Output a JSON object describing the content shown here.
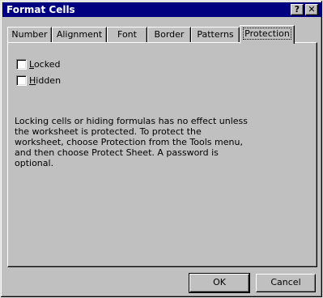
{
  "window": {
    "title": "Format Cells",
    "help_label": "?",
    "close_label": "✕"
  },
  "tabs": [
    {
      "label": "Number"
    },
    {
      "label": "Alignment"
    },
    {
      "label": "Font"
    },
    {
      "label": "Border"
    },
    {
      "label": "Patterns"
    },
    {
      "label": "Protection"
    }
  ],
  "active_tab": "Protection",
  "protection": {
    "locked": {
      "first": "L",
      "rest": "ocked",
      "checked": false
    },
    "hidden": {
      "first": "H",
      "rest": "idden",
      "checked": false
    },
    "note": "Locking cells or hiding formulas has no effect unless the worksheet is protected. To protect the worksheet, choose Protection from the Tools menu, and then choose Protect Sheet. A password is optional."
  },
  "buttons": {
    "ok": "OK",
    "cancel": "Cancel"
  }
}
